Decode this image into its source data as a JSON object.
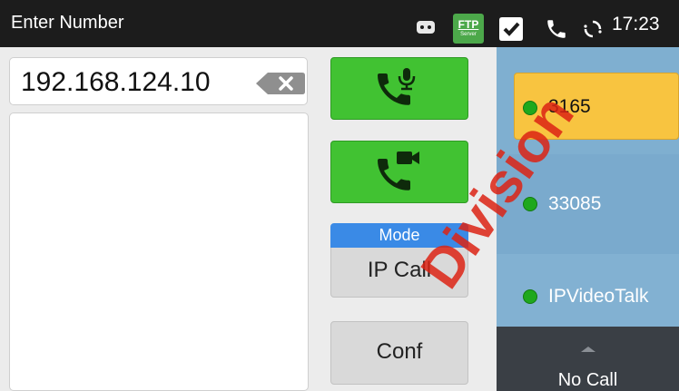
{
  "statusbar": {
    "title": "Enter Number",
    "icons": [
      "voicemail-icon",
      "ftp-server-icon",
      "check-icon",
      "phone-icon",
      "sync-icon"
    ],
    "ftp_label": "FTP",
    "ftp_sub": "Server",
    "time": "17:23"
  },
  "dialer": {
    "number_value": "192.168.124.10"
  },
  "actions": {
    "audio_call_icon": "phone-mic-icon",
    "video_call_icon": "phone-video-icon",
    "mode_label": "Mode",
    "mode_value": "IP Call",
    "conf_label": "Conf"
  },
  "accounts": [
    {
      "label": "3165",
      "status": "registered",
      "selected": true
    },
    {
      "label": "33085",
      "status": "registered",
      "selected": false
    },
    {
      "label": "IPVideoTalk",
      "status": "registered",
      "selected": false
    }
  ],
  "call_status": "No Call",
  "colors": {
    "accent_green": "#41c232",
    "accent_blue": "#3a8ae6",
    "selected_account": "#f8c440",
    "panel_blue": "#7fafd0",
    "status_dot": "#1fa81d"
  }
}
